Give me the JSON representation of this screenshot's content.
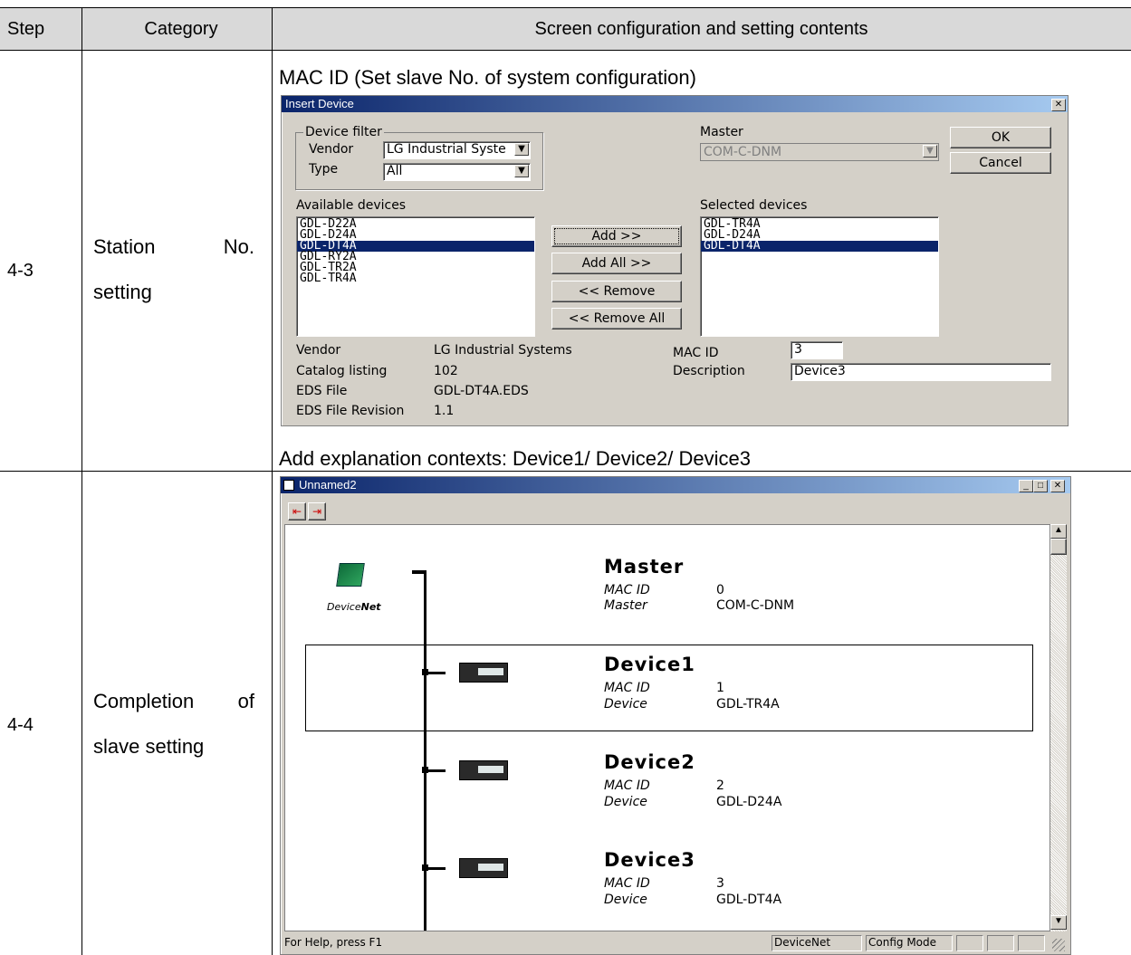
{
  "table": {
    "headers": [
      "Step",
      "Category",
      "Screen configuration and setting contents"
    ],
    "rows": [
      {
        "step": "4-3",
        "category_line1a": "Station",
        "category_line1b": "No.",
        "category_line2": "setting",
        "caption_top": "MAC ID (Set slave No. of system configuration)",
        "caption_bottom": "Add explanation contexts: Device1/ Device2/ Device3"
      },
      {
        "step": "4-4",
        "category_line1a": "Completion",
        "category_line1b": "of",
        "category_line2": "slave setting"
      }
    ]
  },
  "insert_dialog": {
    "title": "Insert Device",
    "close_glyph": "✕",
    "device_filter_label": "Device filter",
    "vendor_label": "Vendor",
    "vendor_value": "LG Industrial Syste",
    "type_label": "Type",
    "type_value": "All",
    "master_label": "Master",
    "master_value": "COM-C-DNM",
    "ok_label": "OK",
    "cancel_label": "Cancel",
    "available_label": "Available devices",
    "available_devices": [
      "GDL-D22A",
      "GDL-D24A",
      "GDL-DT4A",
      "GDL-RY2A",
      "GDL-TR2A",
      "GDL-TR4A"
    ],
    "available_selected": "GDL-DT4A",
    "selected_label": "Selected devices",
    "selected_devices": [
      "GDL-TR4A",
      "GDL-D24A",
      "GDL-DT4A"
    ],
    "selected_selected": "GDL-DT4A",
    "add_btn": "Add >>",
    "add_all_btn": "Add All >>",
    "remove_btn": "<< Remove",
    "remove_all_btn": "<< Remove All",
    "info": {
      "vendor_label": "Vendor",
      "vendor_value": "LG Industrial Systems",
      "catalog_label": "Catalog listing",
      "catalog_value": "102",
      "eds_label": "EDS File",
      "eds_value": "GDL-DT4A.EDS",
      "rev_label": "EDS File Revision",
      "rev_value": "1.1"
    },
    "mac_id_label": "MAC ID",
    "mac_id_value": "3",
    "description_label": "Description",
    "description_value": "Device3"
  },
  "network_window": {
    "title": "Unnamed2",
    "window_buttons": [
      "_",
      "□",
      "✕"
    ],
    "devicenet_logo_text_a": "Device",
    "devicenet_logo_text_b": "Net",
    "nodes": [
      {
        "name": "Master",
        "mac_label": "MAC ID",
        "mac_value": "0",
        "kind_label": "Master",
        "kind_value": "COM-C-DNM"
      },
      {
        "name": "Device1",
        "mac_label": "MAC ID",
        "mac_value": "1",
        "kind_label": "Device",
        "kind_value": "GDL-TR4A"
      },
      {
        "name": "Device2",
        "mac_label": "MAC ID",
        "mac_value": "2",
        "kind_label": "Device",
        "kind_value": "GDL-D24A"
      },
      {
        "name": "Device3",
        "mac_label": "MAC ID",
        "mac_value": "3",
        "kind_label": "Device",
        "kind_value": "GDL-DT4A"
      }
    ],
    "status": {
      "help": "For Help, press F1",
      "network": "DeviceNet",
      "mode": "Config Mode"
    }
  }
}
